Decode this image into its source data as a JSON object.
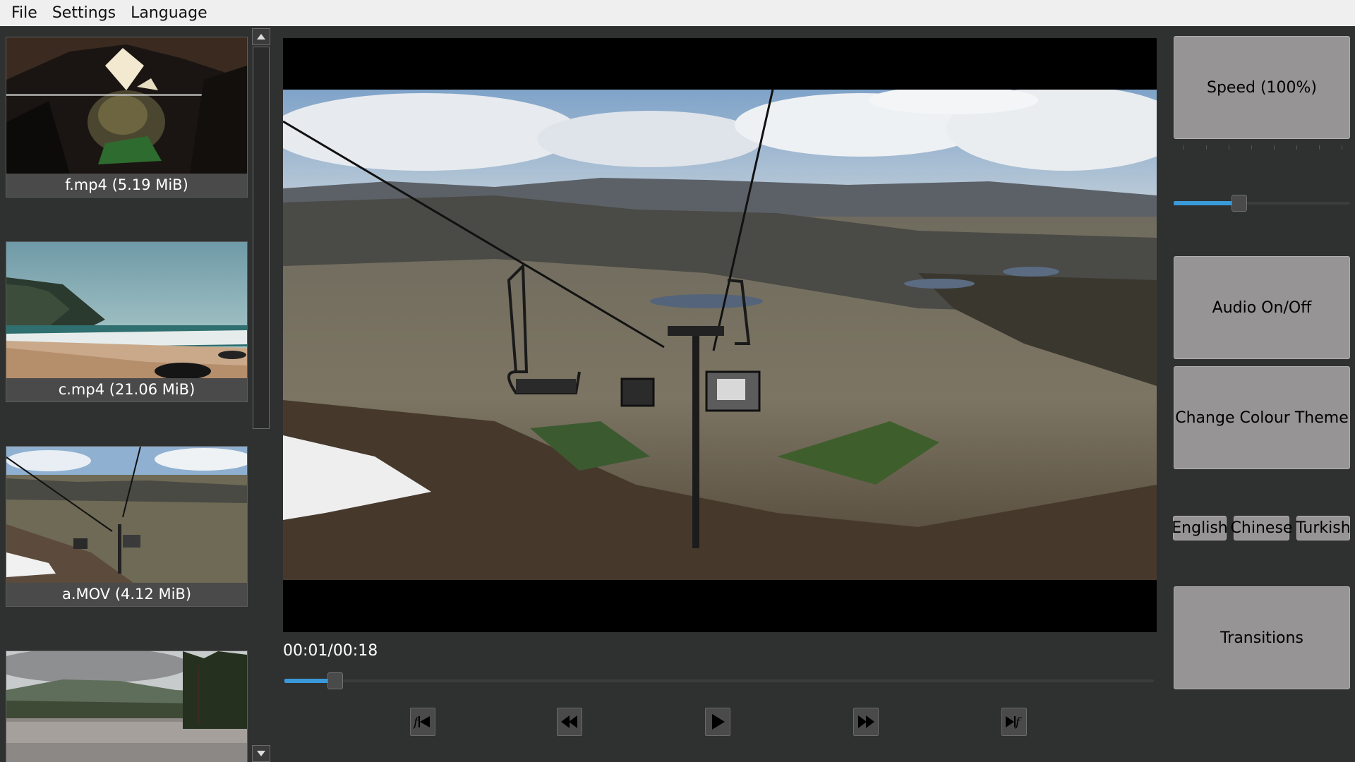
{
  "menu": {
    "items": [
      "File",
      "Settings",
      "Language"
    ]
  },
  "thumbnails": [
    {
      "label": "f.mp4 (5.19 MiB)"
    },
    {
      "label": "c.mp4 (21.06 MiB)"
    },
    {
      "label": "a.MOV (4.12 MiB)"
    }
  ],
  "player": {
    "time": "00:01/00:18",
    "progress": 0.05,
    "controls": [
      "skip-to-start-icon",
      "rewind-icon",
      "play-icon",
      "fast-forward-icon",
      "skip-to-end-icon"
    ],
    "accent": "#3a9ad9"
  },
  "right_panel": {
    "speed_label": "Speed (100%)",
    "speed_level": 0.36,
    "audio_label": "Audio On/Off",
    "theme_label": "Change Colour Theme",
    "languages": [
      "English",
      "Chinese",
      "Turkish"
    ],
    "transitions_label": "Transitions"
  }
}
